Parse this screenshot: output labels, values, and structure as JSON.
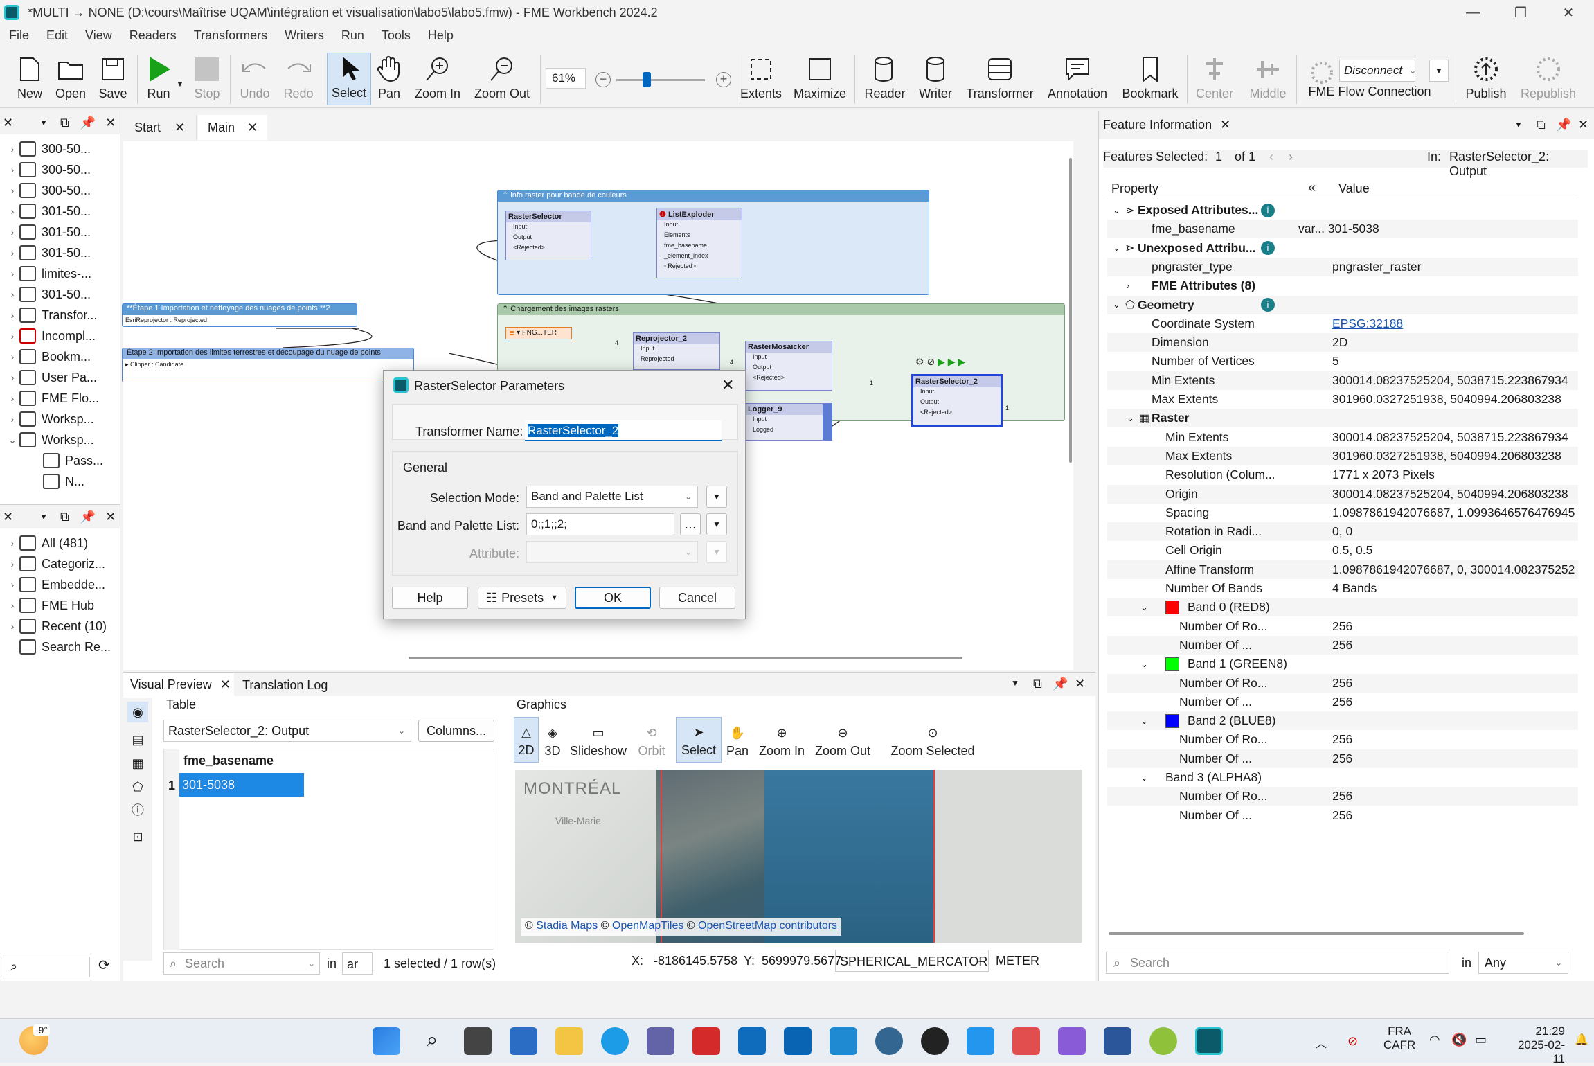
{
  "window": {
    "title": "*MULTI → NONE (D:\\cours\\Maîtrise UQAM\\intégration et visualisation\\labo5\\labo5.fmw) - FME Workbench 2024.2"
  },
  "menu": [
    "File",
    "Edit",
    "View",
    "Readers",
    "Transformers",
    "Writers",
    "Run",
    "Tools",
    "Help"
  ],
  "toolbar": {
    "new": "New",
    "open": "Open",
    "save": "Save",
    "run": "Run",
    "stop": "Stop",
    "undo": "Undo",
    "redo": "Redo",
    "select": "Select",
    "pan": "Pan",
    "zoom_in": "Zoom In",
    "zoom_out": "Zoom Out",
    "zoom_level": "61%",
    "extents": "Extents",
    "maximize": "Maximize",
    "reader": "Reader",
    "writer": "Writer",
    "transformer": "Transformer",
    "annotation": "Annotation",
    "bookmark": "Bookmark",
    "center": "Center",
    "middle": "Middle",
    "connection_select": "Disconnect",
    "fme_flow_connection": "FME Flow Connection",
    "publish": "Publish",
    "republish": "Republish"
  },
  "navigator": {
    "items": [
      "300-50...",
      "300-50...",
      "300-50...",
      "301-50...",
      "301-50...",
      "301-50...",
      "limites-...",
      "301-50...",
      "Transfor...",
      "Incompl...",
      "Bookm...",
      "User Pa...",
      "FME Flo...",
      "Worksp...",
      "Worksp...",
      "Pass...",
      "N..."
    ]
  },
  "gallery": {
    "items": [
      "All (481)",
      "Categoriz...",
      "Embedde...",
      "FME Hub",
      "Recent (10)",
      "Search Re..."
    ]
  },
  "tabs": {
    "start": "Start",
    "main": "Main"
  },
  "canvas": {
    "bookmark1": "info raster pour bande de couleurs",
    "bookmark2": "Chargement des images rasters",
    "bookmark3": "**Étape 1 Importation et nettoyage des nuages de points **2",
    "bookmark4": "Étape 2 Importation des limites terrestres et découpage du nuage de points",
    "port_esri": "EsriReprojector : Reprojected",
    "port_clipper": "Clipper : Candidate",
    "reader_label": "PNG...TER",
    "conn1": "1",
    "conn4a": "4",
    "conn4b": "4",
    "conn1b": "1",
    "nodes": {
      "rasterselector": {
        "name": "RasterSelector",
        "ports": [
          "Input",
          "Output",
          "<Rejected>"
        ]
      },
      "listexploder": {
        "name": "ListExploder",
        "ports": [
          "Input",
          "Elements",
          "fme_basename",
          "_element_index",
          "<Rejected>"
        ]
      },
      "reprojector": {
        "name": "Reprojector_2",
        "ports": [
          "Input",
          "Reprojected"
        ]
      },
      "mosaicker": {
        "name": "RasterMosaicker",
        "ports": [
          "Input",
          "Output",
          "<Rejected>"
        ]
      },
      "logger": {
        "name": "Logger_9",
        "ports": [
          "Input",
          "Logged"
        ]
      },
      "rasterselector2": {
        "name": "RasterSelector_2",
        "ports": [
          "Input",
          "Output",
          "<Rejected>"
        ]
      }
    }
  },
  "dialog": {
    "title": "RasterSelector Parameters",
    "name_label": "Transformer Name:",
    "name_value": "RasterSelector_2",
    "group": "General",
    "mode_label": "Selection Mode:",
    "mode_value": "Band and Palette List",
    "list_label": "Band and Palette List:",
    "list_value": "0;;1;;2;",
    "attr_label": "Attribute:",
    "help": "Help",
    "presets": "Presets",
    "ok": "OK",
    "cancel": "Cancel"
  },
  "feature_info": {
    "title": "Feature Information",
    "selected_label": "Features Selected:",
    "selected": "1",
    "of": "of 1",
    "in_label": "In:",
    "in_value": "RasterSelector_2: Output",
    "col_property": "Property",
    "col_value": "Value",
    "rows": [
      {
        "k": "Exposed Attributes...",
        "v": ""
      },
      {
        "k": "fme_basename",
        "v": "var...  301-5038"
      },
      {
        "k": "Unexposed Attribu...",
        "v": ""
      },
      {
        "k": "pngraster_type",
        "v": "pngraster_raster"
      },
      {
        "k": "FME Attributes (8)",
        "v": ""
      },
      {
        "k": "Geometry",
        "v": ""
      },
      {
        "k": "Coordinate System",
        "v": "EPSG:32188"
      },
      {
        "k": "Dimension",
        "v": "2D"
      },
      {
        "k": "Number of Vertices",
        "v": "5"
      },
      {
        "k": "Min Extents",
        "v": "300014.08237525204, 5038715.223867934"
      },
      {
        "k": "Max Extents",
        "v": "301960.0327251938, 5040994.206803238"
      },
      {
        "k": "Raster",
        "v": ""
      },
      {
        "k": "Min Extents",
        "v": "300014.08237525204, 5038715.223867934"
      },
      {
        "k": "Max Extents",
        "v": "301960.0327251938, 5040994.206803238"
      },
      {
        "k": "Resolution (Colum...",
        "v": "1771 x 2073 Pixels"
      },
      {
        "k": "Origin",
        "v": "300014.08237525204, 5040994.206803238"
      },
      {
        "k": "Spacing",
        "v": "1.0987861942076687, 1.0993646576476945"
      },
      {
        "k": "Rotation in Radi...",
        "v": "0, 0"
      },
      {
        "k": "Cell Origin",
        "v": "0.5, 0.5"
      },
      {
        "k": "Affine Transform",
        "v": "1.0987861942076687, 0, 300014.082375252"
      },
      {
        "k": "Number Of Bands",
        "v": "4 Bands"
      },
      {
        "k": "Band 0 (RED8)",
        "v": ""
      },
      {
        "k": "Number Of Ro...",
        "v": "256"
      },
      {
        "k": "Number Of ...",
        "v": "256"
      },
      {
        "k": "Band 1 (GREEN8)",
        "v": ""
      },
      {
        "k": "Number Of Ro...",
        "v": "256"
      },
      {
        "k": "Number Of ...",
        "v": "256"
      },
      {
        "k": "Band 2 (BLUE8)",
        "v": ""
      },
      {
        "k": "Number Of Ro...",
        "v": "256"
      },
      {
        "k": "Number Of ...",
        "v": "256"
      },
      {
        "k": "Band 3 (ALPHA8)",
        "v": ""
      },
      {
        "k": "Number Of Ro...",
        "v": "256"
      },
      {
        "k": "Number Of ...",
        "v": "256"
      }
    ],
    "search_placeholder": "Search",
    "in": "in",
    "any": "Any"
  },
  "bottom": {
    "tab_visual": "Visual Preview",
    "tab_log": "Translation Log",
    "table_label": "Table",
    "table_select": "RasterSelector_2: Output",
    "columns_btn": "Columns...",
    "col_header": "fme_basename",
    "row_num": "1",
    "row_value": "301-5038",
    "search_placeholder": "Search",
    "in": "in",
    "ar": "ar",
    "status": "1 selected / 1 row(s)",
    "graphics_label": "Graphics",
    "g2d": "2D",
    "g3d": "3D",
    "slideshow": "Slideshow",
    "orbit": "Orbit",
    "select": "Select",
    "pan": "Pan",
    "zoom_in": "Zoom In",
    "zoom_out": "Zoom Out",
    "zoom_selected": "Zoom Selected",
    "map_city": "MONTRÉAL",
    "map_district": "Ville-Marie",
    "attr_c1": "©",
    "attr_stadia": "Stadia Maps",
    "attr_c2": "©",
    "attr_omt": "OpenMapTiles",
    "attr_c3": "©",
    "attr_osm": "OpenStreetMap contributors",
    "x_label": "X:",
    "x_value": "-8186145.5758",
    "y_label": "Y:",
    "y_value": "5699979.5677",
    "crs": "SPHERICAL_MERCATOR",
    "unit": "METER"
  },
  "taskbar": {
    "weather": "-9°",
    "lang1": "FRA",
    "lang2": "CAFR",
    "time": "21:29",
    "date": "2025-02-11"
  },
  "colors": {
    "accent": "#0078d7",
    "selection": "#1e88e5",
    "band0": "#ff0000",
    "band1": "#00ff00",
    "band2": "#0000ff",
    "run_green": "#1aa11a"
  }
}
